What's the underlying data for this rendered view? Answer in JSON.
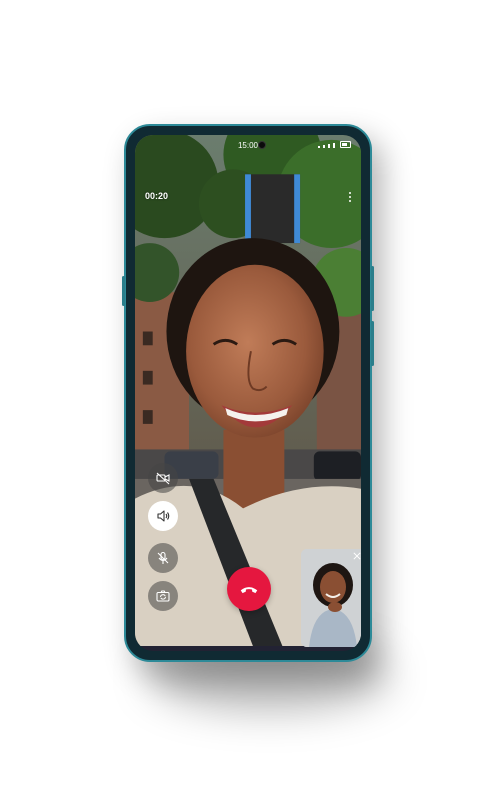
{
  "status_bar": {
    "time": "15:00"
  },
  "call": {
    "duration": "00:20"
  },
  "controls": {
    "video_toggle_icon": "video-off-icon",
    "speaker_icon": "speaker-icon",
    "mute_icon": "mic-off-icon",
    "flip_camera_icon": "flip-camera-icon",
    "end_call_icon": "phone-hangup-icon"
  },
  "colors": {
    "end_call": "#e5173f",
    "phone_frame": "#2d8a98",
    "active_control": "#ffffff"
  }
}
